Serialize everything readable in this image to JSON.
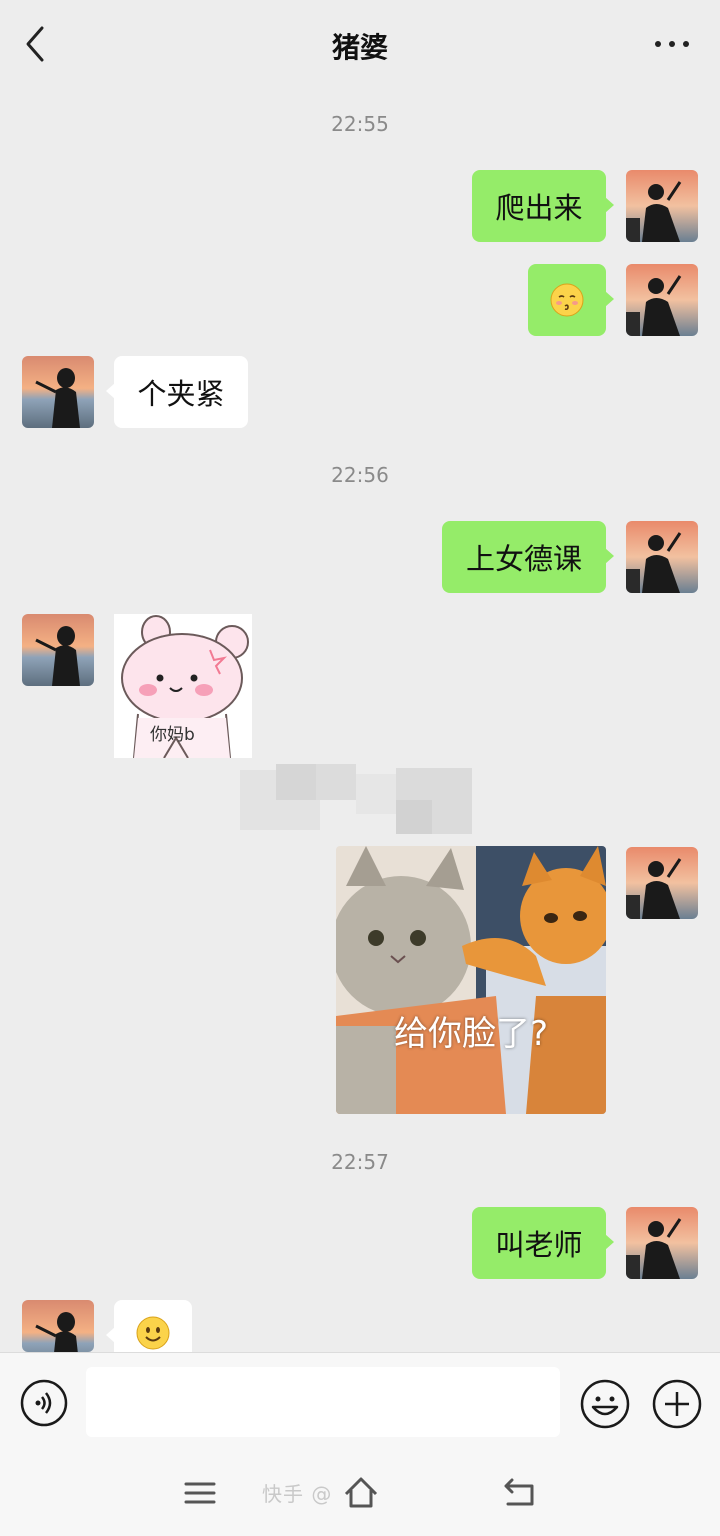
{
  "header": {
    "title": "猪婆"
  },
  "messages": {
    "ts1": "22:55",
    "m1": "爬出来",
    "m3": "个夹紧",
    "ts2": "22:56",
    "m4": "上女德课",
    "sticker_caption": "你妈b",
    "cat_caption": "给你脸了?",
    "ts3": "22:57",
    "m7": "叫老师"
  },
  "icons": {
    "back": "chevron-left-icon",
    "more": "more-dots-icon",
    "voice": "voice-icon",
    "emoji": "emoji-icon",
    "plus": "plus-icon",
    "nav_menu": "menu-icon",
    "nav_home": "home-icon",
    "nav_back": "return-icon"
  },
  "colors": {
    "background": "#ededed",
    "my_bubble": "#95ec69",
    "their_bubble": "#ffffff",
    "timestamp": "#8a8a8a"
  },
  "watermark": "快手 @"
}
